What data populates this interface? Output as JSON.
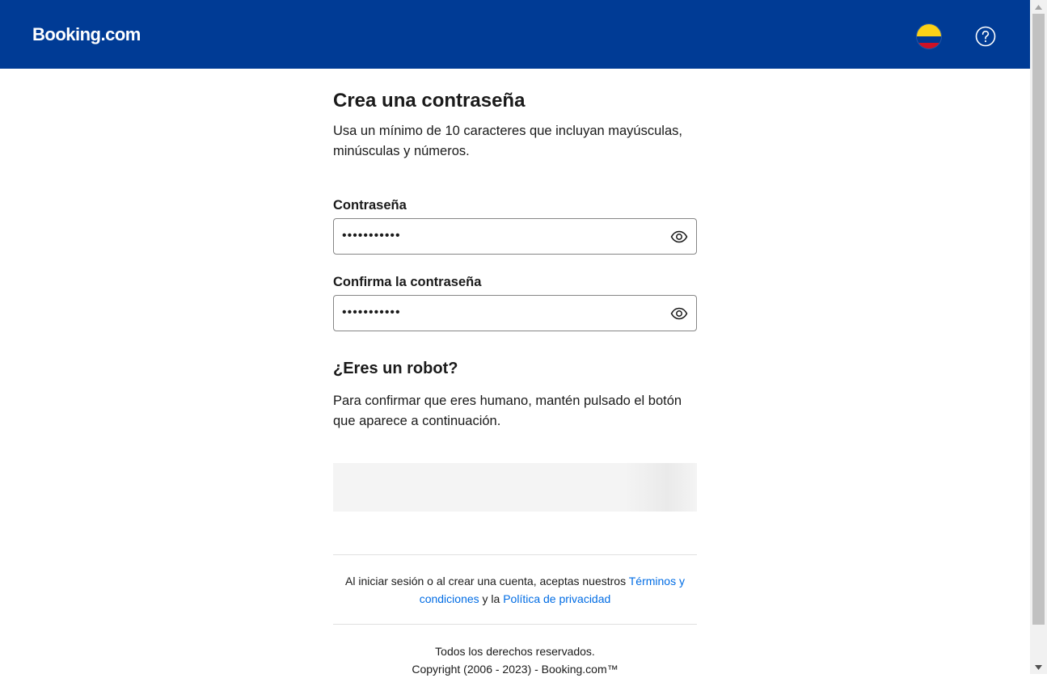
{
  "header": {
    "logo_text": "Booking.com",
    "language_flag_icon": "colombia-flag-icon",
    "help_icon": "question-circle-icon",
    "background_color": "#003b95"
  },
  "main": {
    "title": "Crea una contraseña",
    "description": "Usa un mínimo de 10 caracteres que incluyan mayúsculas, minúsculas y números.",
    "password": {
      "label": "Contraseña",
      "value": "•••••••••••",
      "toggle_icon": "eye-icon"
    },
    "confirm_password": {
      "label": "Confirma la contraseña",
      "value": "•••••••••••",
      "toggle_icon": "eye-icon"
    },
    "robot": {
      "title": "¿Eres un robot?",
      "description": "Para confirmar que eres humano, mantén pulsado el botón que aparece a continuación."
    },
    "terms": {
      "prefix": "Al iniciar sesión o al crear una cuenta, aceptas nuestros ",
      "terms_link": "Términos y condiciones",
      "middle": " y la ",
      "privacy_link": "Política de privacidad",
      "link_color": "#006ce4"
    },
    "footer": {
      "line1": "Todos los derechos reservados.",
      "line2": "Copyright (2006 - 2023) - Booking.com™"
    }
  }
}
